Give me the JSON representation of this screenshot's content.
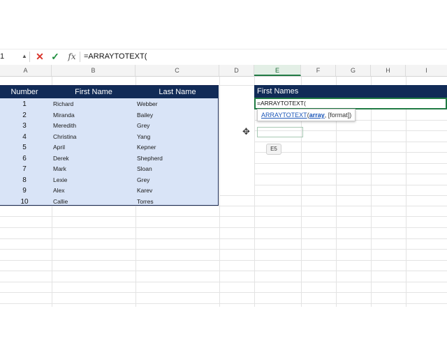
{
  "formula_bar": {
    "name_box": "1",
    "cancel_glyph": "✕",
    "enter_glyph": "✓",
    "fx_label": "fx",
    "formula": "=ARRAYTOTEXT("
  },
  "columns": [
    "A",
    "B",
    "C",
    "D",
    "E",
    "F",
    "G",
    "H",
    "I"
  ],
  "table": {
    "headers": [
      "Number",
      "First Name",
      "Last Name"
    ],
    "rows": [
      [
        "1",
        "Richard",
        "Webber"
      ],
      [
        "2",
        "Miranda",
        "Bailey"
      ],
      [
        "3",
        "Meredith",
        "Grey"
      ],
      [
        "4",
        "Christina",
        "Yang"
      ],
      [
        "5",
        "April",
        "Kepner"
      ],
      [
        "6",
        "Derek",
        "Shepherd"
      ],
      [
        "7",
        "Mark",
        "Sloan"
      ],
      [
        "8",
        "Lexie",
        "Grey"
      ],
      [
        "9",
        "Alex",
        "Karev"
      ],
      [
        "10",
        "Callie",
        "Torres"
      ]
    ]
  },
  "first_names": {
    "header": "First Names",
    "cell_value": "=ARRAYTOTEXT("
  },
  "tooltip": {
    "function": "ARRAYTOTEXT",
    "open_paren": "(",
    "arg_array": "array",
    "rest": ", [format])"
  },
  "cell_badge": "E5",
  "icons": {
    "cursor": "cross-cursor-icon"
  },
  "colors": {
    "header_navy": "#112b57",
    "table_fill": "#d9e4f7",
    "active_green": "#1f7a43"
  }
}
